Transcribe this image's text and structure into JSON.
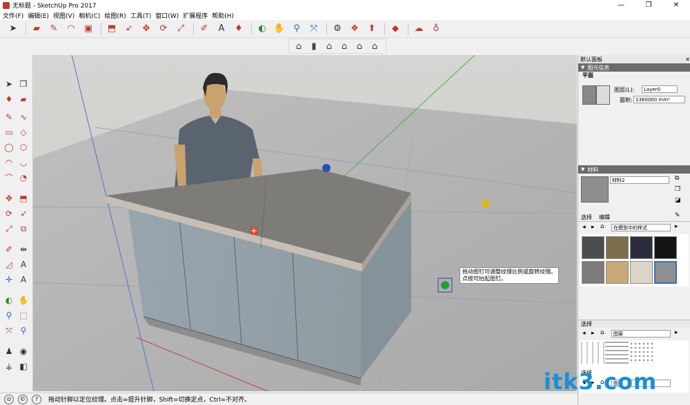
{
  "window": {
    "title": "无标题 - SketchUp Pro 2017",
    "minimize": "—",
    "maximize": "❐",
    "close": "✕"
  },
  "menu": [
    "文件(F)",
    "编辑(E)",
    "视图(V)",
    "相机(C)",
    "绘图(R)",
    "工具(T)",
    "窗口(W)",
    "扩展程序",
    "帮助(H)"
  ],
  "tooltip": {
    "line1": "拖动图钉可调整纹理比例或旋转纹理。",
    "line2": "点按可抬起图钉。"
  },
  "panel": {
    "title": "默认面板",
    "entity_section": "图元信息",
    "entity_type": "平面",
    "layer_label": "图层(L):",
    "layer_value": "Layer0",
    "area_label": "面积:",
    "area_value": "1360000 mm²",
    "materials_section": "材料",
    "material_name": "材料2",
    "tab_select": "选择",
    "tab_edit": "编辑",
    "library_dropdown": "在模型中的样式",
    "lower_select_label": "选择",
    "lower_dropdown": "图案",
    "bottom_select_label": "选择",
    "bottom_dropdown": "图案"
  },
  "swatch_colors": [
    "#4b4e4e",
    "#7b6f4c",
    "#2b2d3c",
    "#151515",
    "#7d7b79",
    "#c8a878",
    "#ddd6c8",
    "#8f8f8f"
  ],
  "status": {
    "message": "拖动针脚以定位纹理。点击=提升针脚，Shift=切换定点，Ctrl=不对齐。"
  },
  "watermark": "itk3.com"
}
